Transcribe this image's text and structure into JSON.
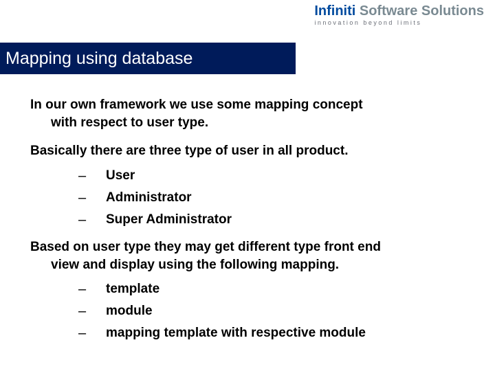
{
  "logo": {
    "brand_prefix": "Infiniti",
    "brand_suffix": " Software Solutions",
    "tagline": "innovation beyond limits"
  },
  "title": "Mapping using database",
  "body": {
    "para1_line1": "In our own framework we use some mapping concept",
    "para1_line2": "with respect to user type.",
    "para2": "Basically there are three type of user in all product.",
    "list1": [
      {
        "label": "User"
      },
      {
        "label": "Administrator"
      },
      {
        "label": "Super Administrator"
      }
    ],
    "para3_line1": "Based on user type they may get different type front end",
    "para3_line2": "view and display using the following mapping.",
    "list2": [
      {
        "label": "template"
      },
      {
        "label": "module"
      },
      {
        "label": "mapping template with respective module"
      }
    ]
  },
  "bullet_dash": "–"
}
